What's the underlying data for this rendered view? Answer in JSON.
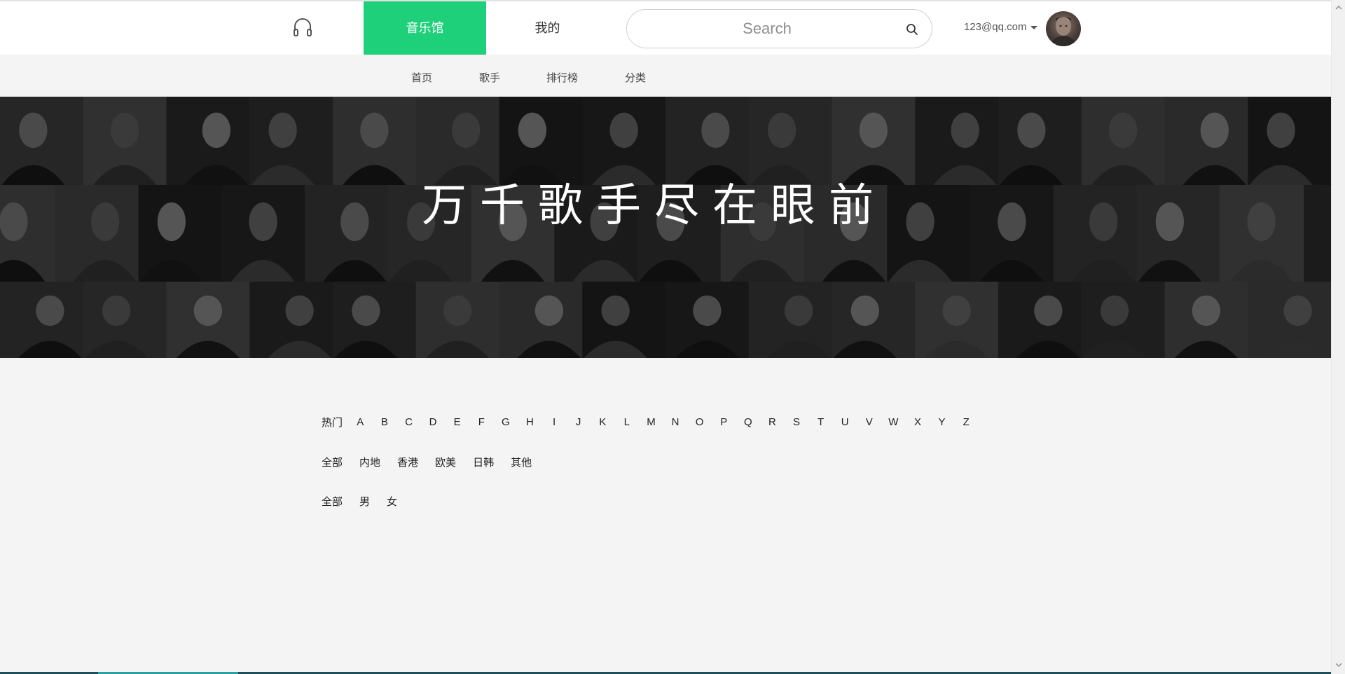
{
  "header": {
    "logo_icon": "headphones-icon",
    "tabs": [
      {
        "label": "音乐馆",
        "active": true
      },
      {
        "label": "我的",
        "active": false
      }
    ],
    "search": {
      "placeholder": "Search",
      "icon": "search-icon"
    },
    "user": {
      "email": "123@qq.com",
      "dropdown_icon": "caret-down-icon"
    }
  },
  "subnav": {
    "items": [
      {
        "label": "首页"
      },
      {
        "label": "歌手"
      },
      {
        "label": "排行榜"
      },
      {
        "label": "分类"
      }
    ]
  },
  "banner": {
    "title": "万千歌手尽在眼前"
  },
  "filters": {
    "index": [
      "热门",
      "A",
      "B",
      "C",
      "D",
      "E",
      "F",
      "G",
      "H",
      "I",
      "J",
      "K",
      "L",
      "M",
      "N",
      "O",
      "P",
      "Q",
      "R",
      "S",
      "T",
      "U",
      "V",
      "W",
      "X",
      "Y",
      "Z"
    ],
    "region": [
      "全部",
      "内地",
      "香港",
      "欧美",
      "日韩",
      "其他"
    ],
    "gender": [
      "全部",
      "男",
      "女"
    ]
  },
  "colors": {
    "accent": "#1fd07a",
    "background": "#f4f4f4",
    "header_bg": "#ffffff",
    "banner_bg": "#1b1b1b"
  }
}
